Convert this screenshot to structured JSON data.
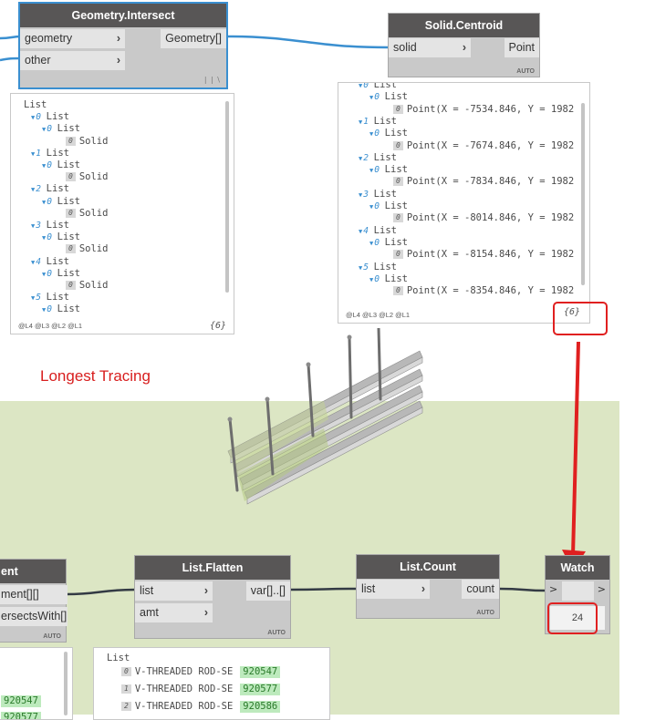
{
  "group": {
    "title": "Longest Tracing"
  },
  "nodes": {
    "intersect": {
      "title": "Geometry.Intersect",
      "in1": "geometry",
      "in2": "other",
      "out": "Geometry[]",
      "lacing": "| | \\"
    },
    "centroid": {
      "title": "Solid.Centroid",
      "in1": "solid",
      "out": "Point",
      "auto": "AUTO"
    },
    "element": {
      "title": "ent",
      "out1": "ment[][]",
      "out2": "ersectsWith[]",
      "auto": "AUTO"
    },
    "flatten": {
      "title": "List.Flatten",
      "in1": "list",
      "in2": "amt",
      "out": "var[]..[]",
      "auto": "AUTO"
    },
    "count": {
      "title": "List.Count",
      "in1": "list",
      "out": "count",
      "auto": "AUTO"
    },
    "watch": {
      "title": "Watch",
      "in1": ">",
      "out": ">",
      "value": "24"
    }
  },
  "previews": {
    "intersect": {
      "root": "List",
      "lines": [
        {
          "i": "0",
          "t": "List"
        },
        {
          "i": "0",
          "t": "List"
        },
        {
          "i": "0",
          "t": "Solid",
          "leaf": true
        },
        {
          "i": "1",
          "t": "List"
        },
        {
          "i": "0",
          "t": "List"
        },
        {
          "i": "0",
          "t": "Solid",
          "leaf": true
        },
        {
          "i": "2",
          "t": "List"
        },
        {
          "i": "0",
          "t": "List"
        },
        {
          "i": "0",
          "t": "Solid",
          "leaf": true
        },
        {
          "i": "3",
          "t": "List"
        },
        {
          "i": "0",
          "t": "List"
        },
        {
          "i": "0",
          "t": "Solid",
          "leaf": true
        },
        {
          "i": "4",
          "t": "List"
        },
        {
          "i": "0",
          "t": "List"
        },
        {
          "i": "0",
          "t": "Solid",
          "leaf": true
        },
        {
          "i": "5",
          "t": "List"
        },
        {
          "i": "0",
          "t": "List"
        }
      ],
      "levels": "@L4 @L3 @L2 @L1",
      "count": "{6}"
    },
    "centroid": {
      "lines": [
        {
          "i": "0",
          "t": "List"
        },
        {
          "i": "0",
          "t": "List"
        },
        {
          "i": "0",
          "t": "Point(X = -7534.846, Y = 1982",
          "leaf": true
        },
        {
          "i": "1",
          "t": "List"
        },
        {
          "i": "0",
          "t": "List"
        },
        {
          "i": "0",
          "t": "Point(X = -7674.846, Y = 1982",
          "leaf": true
        },
        {
          "i": "2",
          "t": "List"
        },
        {
          "i": "0",
          "t": "List"
        },
        {
          "i": "0",
          "t": "Point(X = -7834.846, Y = 1982",
          "leaf": true
        },
        {
          "i": "3",
          "t": "List"
        },
        {
          "i": "0",
          "t": "List"
        },
        {
          "i": "0",
          "t": "Point(X = -8014.846, Y = 1982",
          "leaf": true
        },
        {
          "i": "4",
          "t": "List"
        },
        {
          "i": "0",
          "t": "List"
        },
        {
          "i": "0",
          "t": "Point(X = -8154.846, Y = 1982",
          "leaf": true
        },
        {
          "i": "5",
          "t": "List"
        },
        {
          "i": "0",
          "t": "List"
        },
        {
          "i": "0",
          "t": "Point(X = -8354.846, Y = 1982",
          "leaf": true
        }
      ],
      "levels": "@L4 @L3 @L2 @L1",
      "count": "{6}"
    },
    "element": {
      "values": [
        "920547",
        "920577"
      ]
    },
    "flatten": {
      "root": "List",
      "rows": [
        {
          "i": "0",
          "name": "V-THREADED ROD-SE",
          "id": "920547"
        },
        {
          "i": "1",
          "name": "V-THREADED ROD-SE",
          "id": "920577"
        },
        {
          "i": "2",
          "name": "V-THREADED ROD-SE",
          "id": "920586"
        }
      ]
    }
  },
  "colors": {
    "accent": "#3a8fd0",
    "annotation": "#e02020",
    "group_bg": "#dce6c4",
    "node_header": "#585656"
  }
}
